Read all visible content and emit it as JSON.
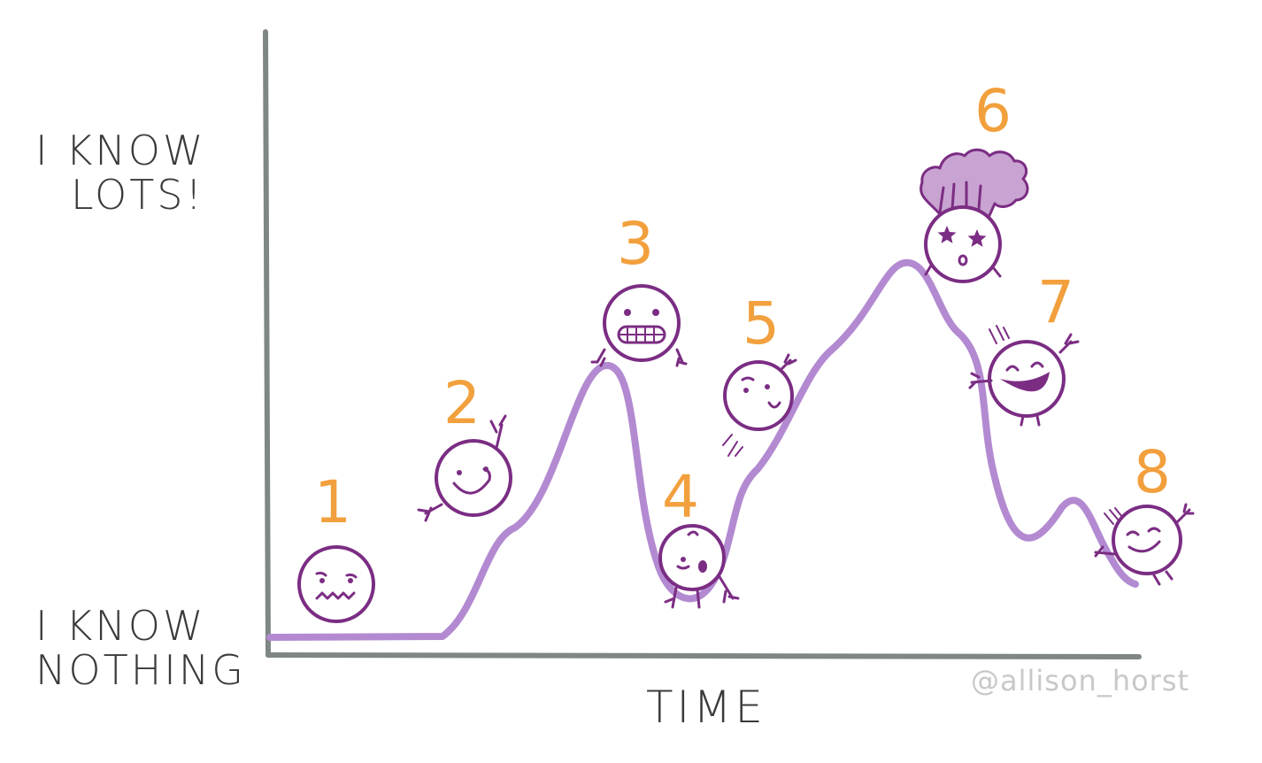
{
  "axes": {
    "y_top_label": [
      "I KNOW",
      "LOTS!"
    ],
    "y_bottom_label": [
      "I KNOW",
      "NOTHING"
    ],
    "x_label": "TIME"
  },
  "stages": [
    {
      "number": "1",
      "face": "worried"
    },
    {
      "number": "2",
      "face": "smiling-waving"
    },
    {
      "number": "3",
      "face": "grimacing"
    },
    {
      "number": "4",
      "face": "surprised-falling"
    },
    {
      "number": "5",
      "face": "content-climbing"
    },
    {
      "number": "6",
      "face": "starstruck-mind-blown"
    },
    {
      "number": "7",
      "face": "laughing-sliding"
    },
    {
      "number": "8",
      "face": "calm-smiling"
    }
  ],
  "credit": "@allison_horst",
  "colors": {
    "axis": "#7f8783",
    "curve": "#b38ad1",
    "character": "#7b2d83",
    "number": "#f2a03d",
    "explosion": "#c9a3d1",
    "credit": "#c8c8c8"
  }
}
